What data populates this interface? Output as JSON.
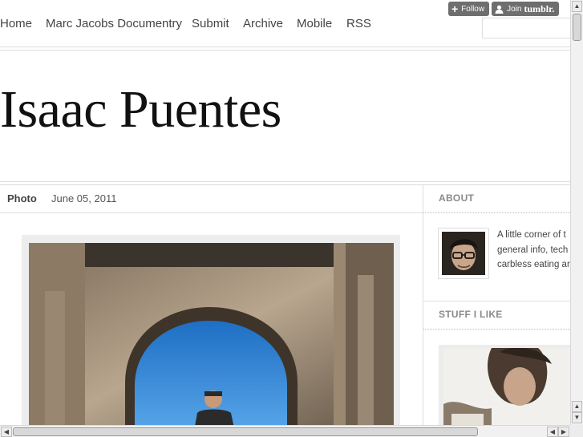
{
  "nav": {
    "items": [
      "Home",
      "Marc Jacobs Documentry",
      "Submit",
      "Archive",
      "Mobile",
      "RSS"
    ],
    "search_value": ""
  },
  "tumblr_controls": {
    "follow_label": "Follow",
    "join_label": "Join",
    "brand": "tumblr."
  },
  "site": {
    "title": "Isaac Puentes"
  },
  "post": {
    "type": "Photo",
    "date": "June 05, 2011"
  },
  "sidebar": {
    "about_heading": "ABOUT",
    "about_lines": [
      "A little corner of t",
      "general info, tech",
      "carbless eating ar"
    ],
    "stuff_heading": "STUFF I LIKE"
  },
  "icons": {
    "follow": "plus-icon",
    "join": "person-icon"
  },
  "colors": {
    "tumblr_button": "#6e6e6e",
    "sky": "#2f86d6",
    "sidebar_heading": "#8a8a8a"
  }
}
